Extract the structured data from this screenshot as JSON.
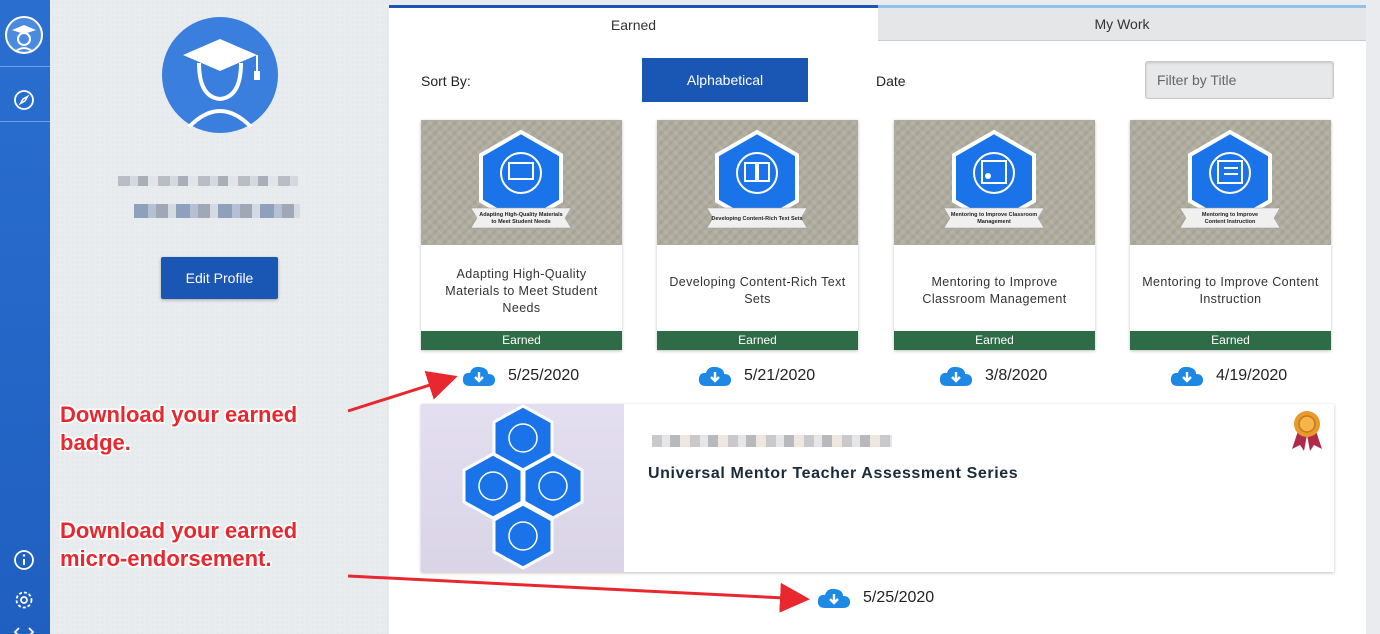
{
  "profile": {
    "edit_label": "Edit Profile"
  },
  "tabs": {
    "earned": "Earned",
    "my_work": "My Work"
  },
  "sort": {
    "label": "Sort By:",
    "alphabetical": "Alphabetical",
    "date": "Date"
  },
  "filter": {
    "placeholder": "Filter by Title"
  },
  "badges": [
    {
      "title": "Adapting High-Quality Materials to Meet Student Needs",
      "status": "Earned",
      "date": "5/25/2020",
      "ribbon": "Adapting High-Quality Materials to Meet Student Needs"
    },
    {
      "title": "Developing Content-Rich Text Sets",
      "status": "Earned",
      "date": "5/21/2020",
      "ribbon": "Developing Content-Rich Text Sets"
    },
    {
      "title": "Mentoring to Improve Classroom Management",
      "status": "Earned",
      "date": "3/8/2020",
      "ribbon": "Mentoring to Improve Classroom Management"
    },
    {
      "title": "Mentoring to Improve Content Instruction",
      "status": "Earned",
      "date": "4/19/2020",
      "ribbon": "Mentoring to Improve Content Instruction"
    }
  ],
  "endorsement": {
    "title": "Universal Mentor Teacher Assessment Series",
    "date": "5/25/2020"
  },
  "annotations": {
    "badge_line1": "Download your earned",
    "badge_line2": "badge.",
    "micro_line1": "Download your earned",
    "micro_line2": "micro-endorsement."
  },
  "colors": {
    "primary": "#1a56b4",
    "earned_green": "#2e6b47",
    "annotation_red": "#e8282e",
    "rail": "#2a6fd0"
  },
  "icons": {
    "rail": [
      "avatar-icon",
      "compass-icon",
      "info-icon",
      "gear-icon",
      "collapse-icon"
    ],
    "download": "cloud-download-icon",
    "award": "award-ribbon-icon"
  }
}
